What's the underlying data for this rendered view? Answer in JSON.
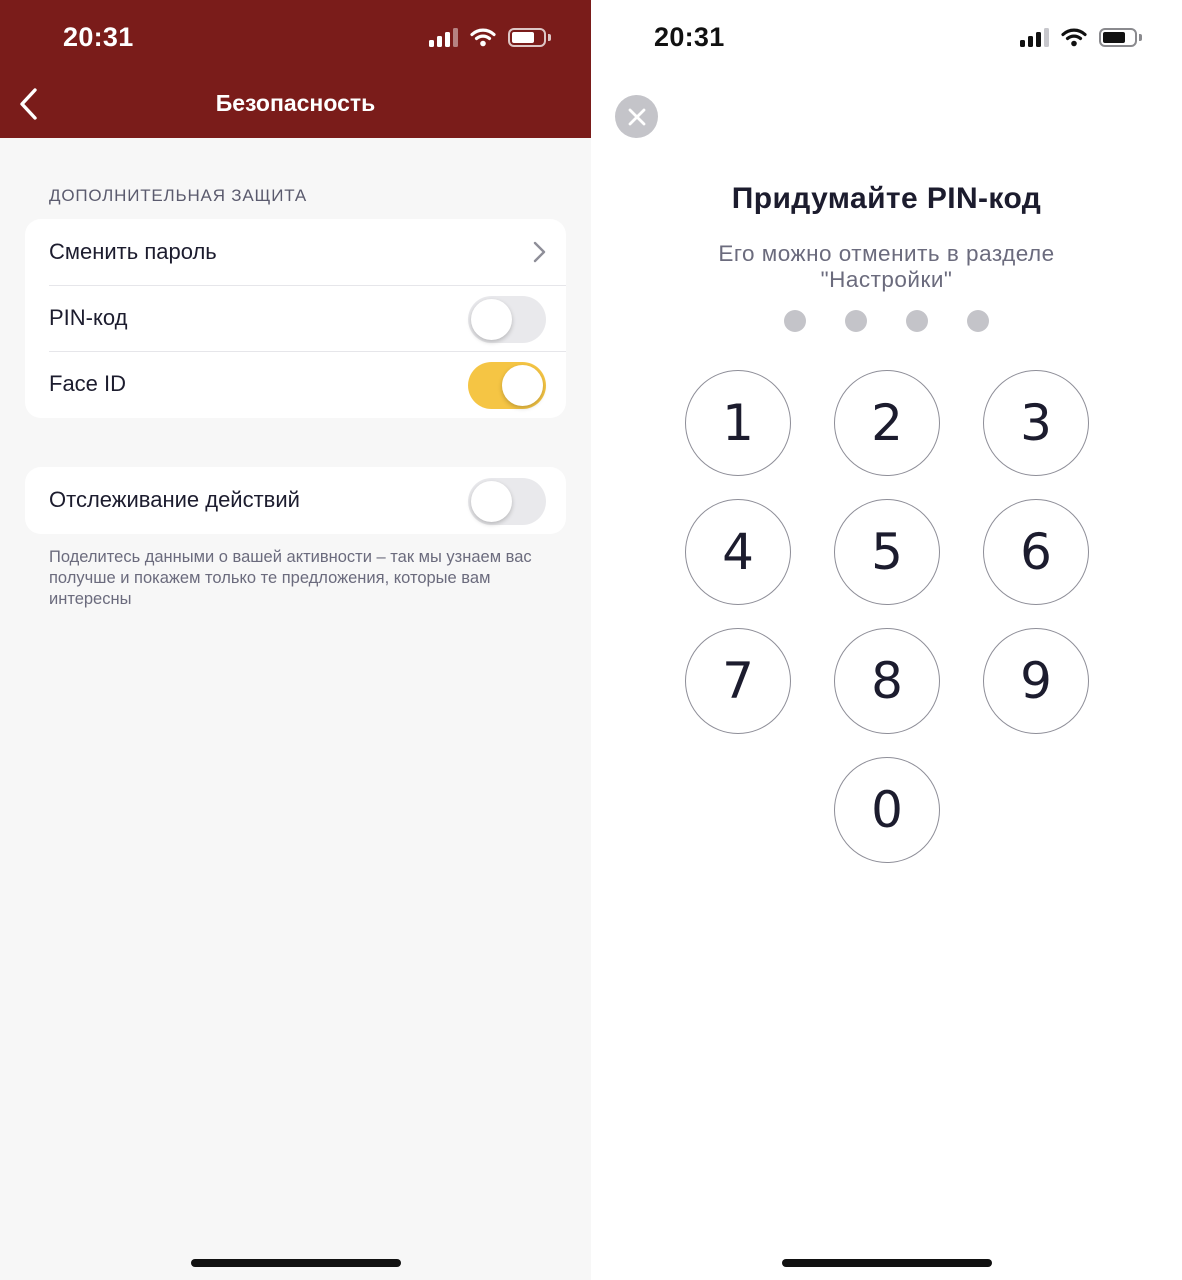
{
  "left_screen": {
    "status_bar": {
      "time": "20:31"
    },
    "nav": {
      "title": "Безопасность"
    },
    "section_label": "ДОПОЛНИТЕЛЬНАЯ ЗАЩИТА",
    "settings": [
      {
        "label": "Сменить пароль",
        "control": "chevron"
      },
      {
        "label": "PIN-код",
        "control": "toggle",
        "on": false
      },
      {
        "label": "Face ID",
        "control": "toggle",
        "on": true
      }
    ],
    "tracking": {
      "label": "Отслеживание действий",
      "on": false
    },
    "footnote": "Поделитесь данными о вашей активности – так мы узнаем вас получше и покажем только те предложения, которые вам интересны"
  },
  "right_screen": {
    "status_bar": {
      "time": "20:31"
    },
    "title": "Придумайте PIN-код",
    "subtitle": "Его можно отменить в разделе \"Настройки\"",
    "pin_length": 4,
    "keys": [
      "1",
      "2",
      "3",
      "4",
      "5",
      "6",
      "7",
      "8",
      "9",
      "0"
    ]
  },
  "colors": {
    "header_bg": "#7a1c1a",
    "toggle_on": "#f5c544",
    "toggle_off": "#e9e9ec",
    "pin_dot": "#c4c4c9"
  },
  "icons": {
    "back": "chevron-left-icon",
    "row_chevron": "chevron-right-icon",
    "close": "close-icon",
    "signal": "cellular-signal-icon",
    "wifi": "wifi-icon",
    "battery": "battery-icon"
  }
}
